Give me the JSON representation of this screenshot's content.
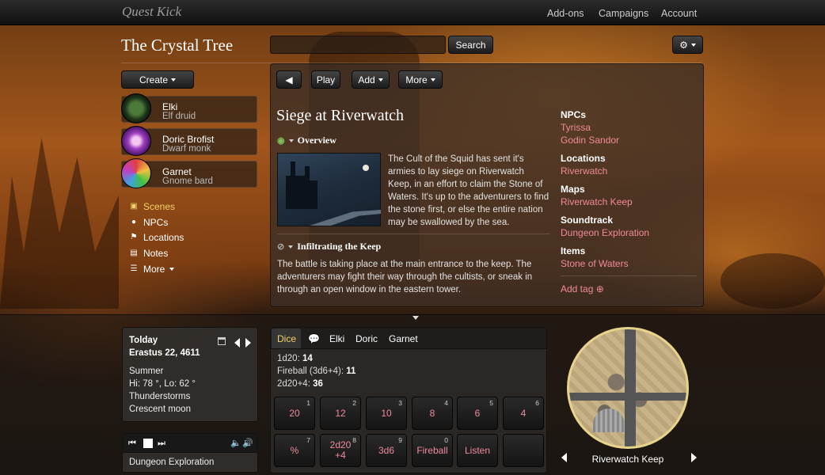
{
  "app": {
    "brand": "Quest Kick"
  },
  "nav": [
    "Add-ons",
    "Campaigns",
    "Account"
  ],
  "header": {
    "title": "The Crystal Tree",
    "search_placeholder": "",
    "search_label": "Search"
  },
  "sidebar": {
    "create_label": "Create",
    "characters": [
      {
        "name": "Elki",
        "sub": "Elf druid"
      },
      {
        "name": "Doric Brofist",
        "sub": "Dwarf monk"
      },
      {
        "name": "Garnet",
        "sub": "Gnome bard"
      }
    ],
    "nav": [
      {
        "label": "Scenes",
        "icon": "image-icon"
      },
      {
        "label": "NPCs",
        "icon": "users-icon"
      },
      {
        "label": "Locations",
        "icon": "flag-icon"
      },
      {
        "label": "Notes",
        "icon": "book-icon"
      },
      {
        "label": "More",
        "icon": "list-icon"
      }
    ]
  },
  "toolbar": {
    "play": "Play",
    "add": "Add",
    "more": "More"
  },
  "scene": {
    "title": "Siege at Riverwatch",
    "overview_label": "Overview",
    "overview_text": "The Cult of the Squid has sent it's armies to lay siege on Riverwatch Keep, in an effort to claim the Stone of Waters. It's up to the adventurers to find the stone first, or else the entire nation may be swallowed by the sea.",
    "section2_label": "Infiltrating the Keep",
    "section2_text": "The battle is taking place at the main entrance to the keep. The adventurers may fight their way through the cultists, or sneak in through an open window in the eastern tower."
  },
  "tags": {
    "npcs_label": "NPCs",
    "npcs": [
      "Tyrissa",
      "Godin Sandor"
    ],
    "locations_label": "Locations",
    "locations": [
      "Riverwatch"
    ],
    "maps_label": "Maps",
    "maps": [
      "Riverwatch Keep"
    ],
    "soundtrack_label": "Soundtrack",
    "soundtrack": [
      "Dungeon Exploration"
    ],
    "items_label": "Items",
    "items": [
      "Stone of Waters"
    ],
    "add_tag": "Add tag"
  },
  "calendar": {
    "day": "Tolday",
    "date": "Erastus 22, 4611",
    "season": "Summer",
    "temps": "Hi: 78 °, Lo: 62 °",
    "weather": "Thunderstorms",
    "moon": "Crescent moon"
  },
  "player": {
    "track": "Dungeon Exploration"
  },
  "dice": {
    "tabs": [
      "Dice",
      "Elki",
      "Doric",
      "Garnet"
    ],
    "rolls": [
      {
        "expr": "1d20:",
        "result": "14"
      },
      {
        "expr": "Fireball (3d6+4):",
        "result": "11"
      },
      {
        "expr": "2d20+4:",
        "result": "36"
      }
    ],
    "buttons": [
      {
        "label": "20",
        "num": "1"
      },
      {
        "label": "12",
        "num": "2"
      },
      {
        "label": "10",
        "num": "3"
      },
      {
        "label": "8",
        "num": "4"
      },
      {
        "label": "6",
        "num": "5"
      },
      {
        "label": "4",
        "num": "6"
      },
      {
        "label": "%",
        "num": "7"
      },
      {
        "label": "2d20\n+4",
        "num": "8"
      },
      {
        "label": "3d6",
        "num": "9"
      },
      {
        "label": "Fireball",
        "num": "0"
      },
      {
        "label": "Listen",
        "num": ""
      },
      {
        "label": "",
        "num": ""
      }
    ]
  },
  "map": {
    "label": "Riverwatch Keep"
  }
}
